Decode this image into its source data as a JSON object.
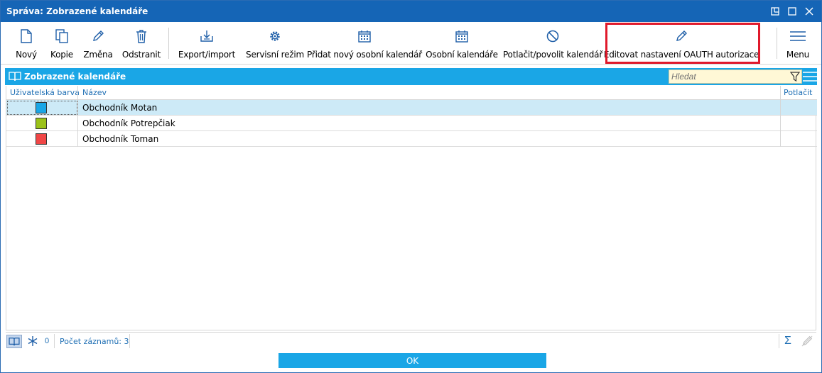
{
  "window": {
    "title": "Správa: Zobrazené kalendáře",
    "controls": [
      "restore-icon",
      "maximize-icon",
      "close-icon"
    ]
  },
  "toolbar": {
    "new_label": "Nový",
    "copy_label": "Kopie",
    "edit_label": "Změna",
    "delete_label": "Odstranit",
    "export_label": "Export/import",
    "service_label": "Servisní režim",
    "add_personal_label": "Přidat nový osobní kalendář",
    "personal_label": "Osobní kalendáře",
    "suppress_label": "Potlačit/povolit kalendář",
    "oauth_label": "Editovat nastavení OAUTH autorizace",
    "menu_label": "Menu",
    "highlight_color": "#e0192b"
  },
  "panel": {
    "title": "Zobrazené kalendáře",
    "search_placeholder": "Hledat",
    "header_color": "#1aa6e6"
  },
  "grid": {
    "columns": [
      "Uživatelská barva",
      "Název",
      "Potlačit"
    ],
    "rows": [
      {
        "color": "#1aa6e6",
        "name": "Obchodník Motan",
        "selected": true
      },
      {
        "color": "#9bc21a",
        "name": "Obchodník Potrepčiak",
        "selected": false
      },
      {
        "color": "#f04646",
        "name": "Obchodník Toman",
        "selected": false
      }
    ]
  },
  "status": {
    "count": "0",
    "records": "Počet záznamů: 3",
    "sum_symbol": "Σ"
  },
  "ok_label": "OK"
}
